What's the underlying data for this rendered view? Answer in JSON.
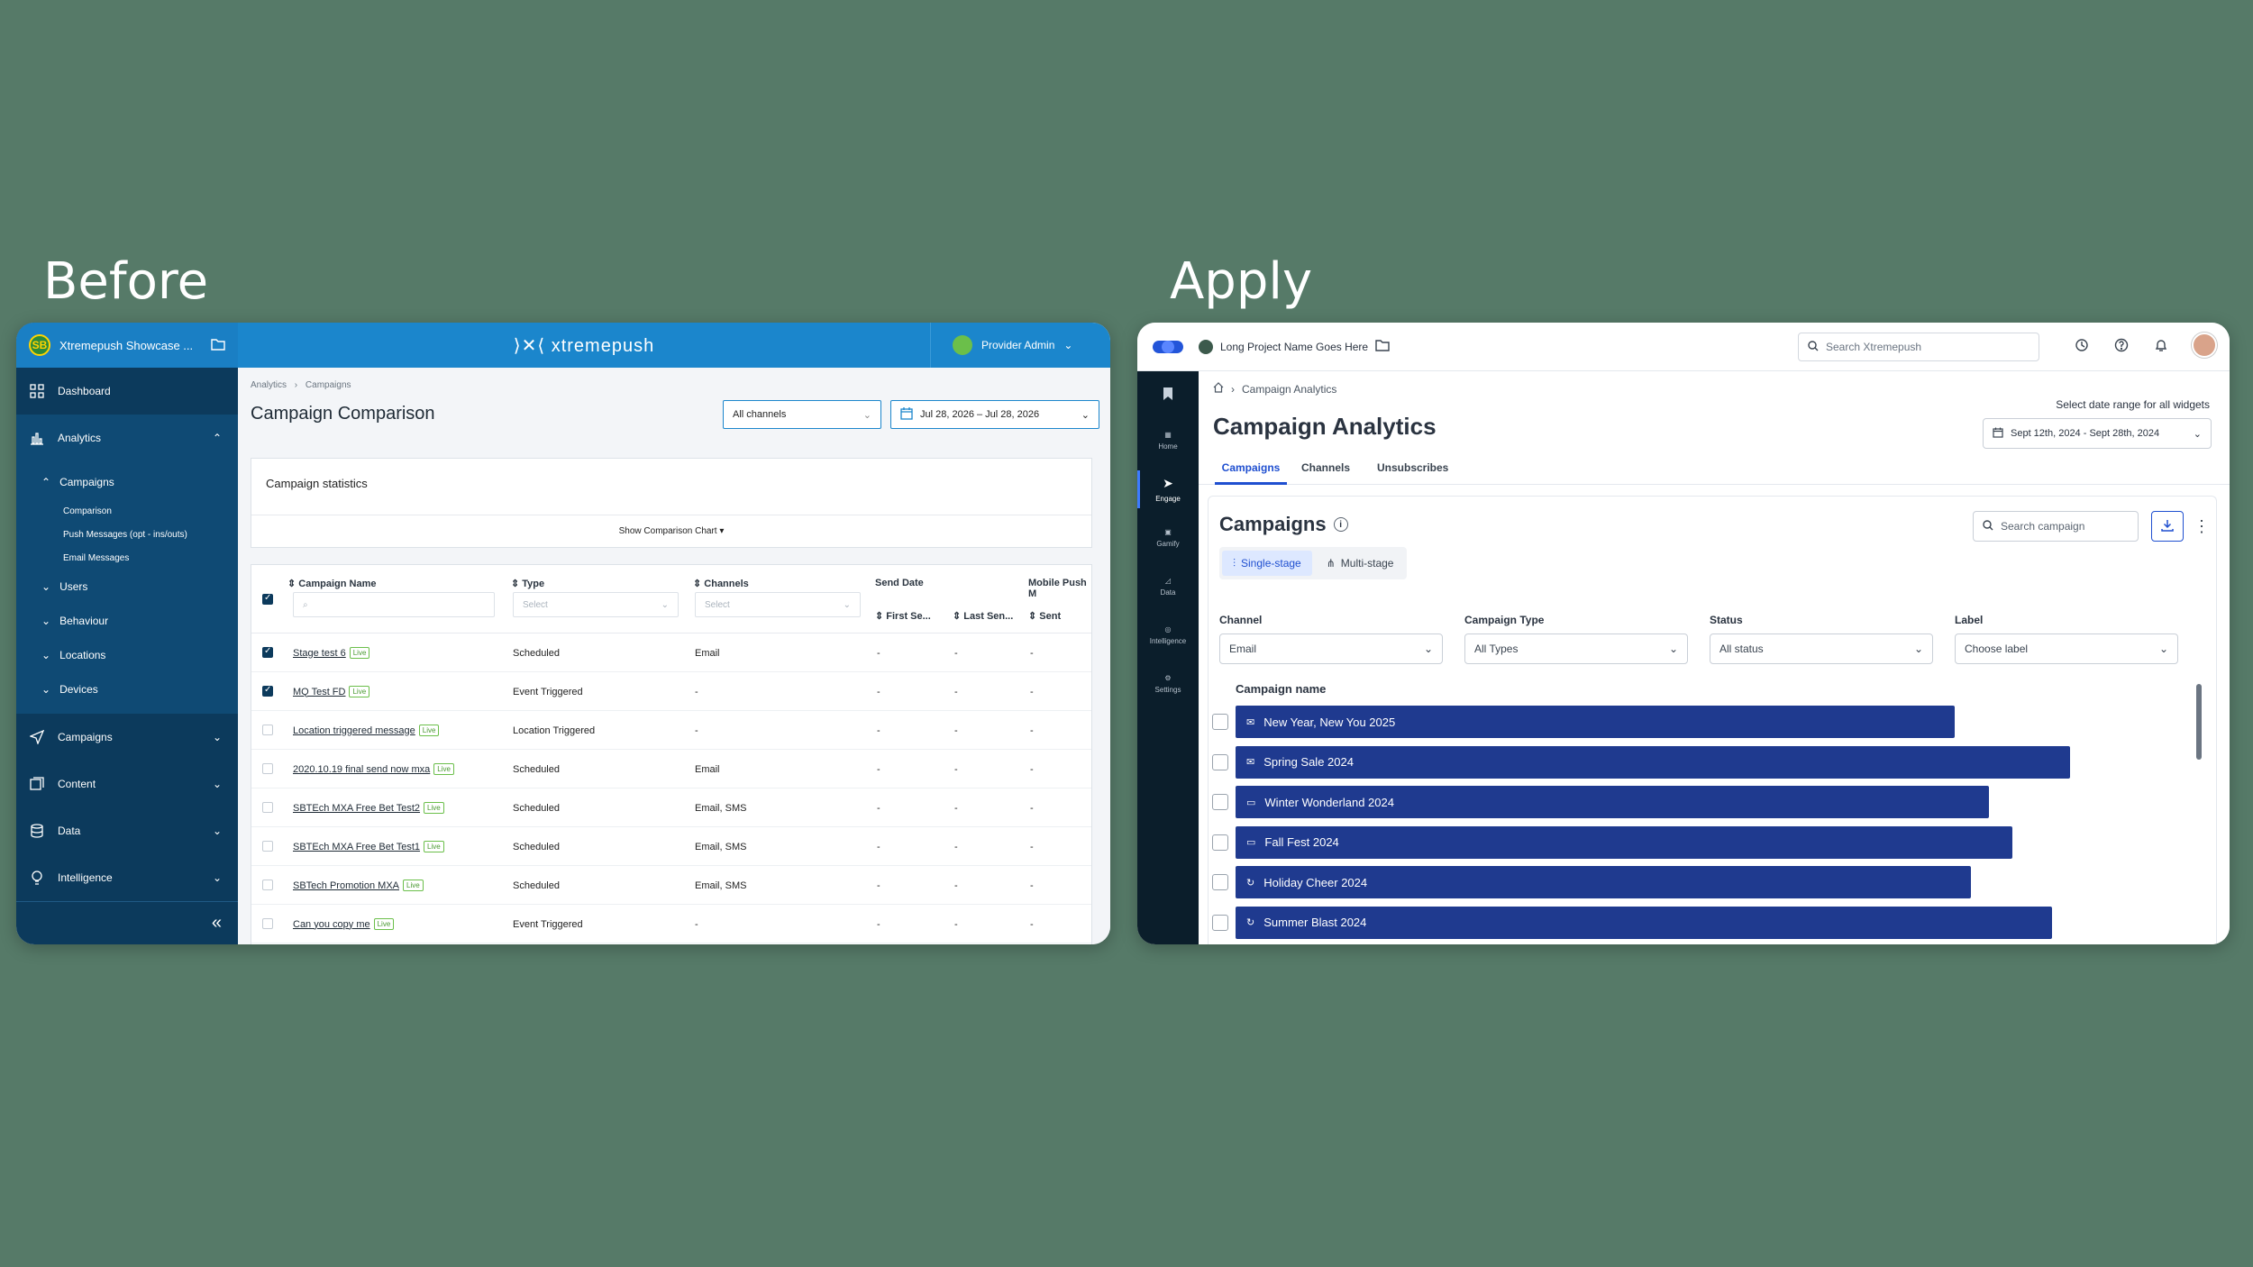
{
  "headings": {
    "before": "Before",
    "after": "Apply"
  },
  "before": {
    "workspace": "Xtremepush Showcase ...",
    "workspace_initials": "SB",
    "brand": "xtremepush",
    "user": "Provider Admin",
    "nav": {
      "dashboard": "Dashboard",
      "analytics": "Analytics",
      "campaigns_sub": "Campaigns",
      "comparison": "Comparison",
      "push_messages": "Push Messages (opt - ins/outs)",
      "email_messages": "Email Messages",
      "users": "Users",
      "behaviour": "Behaviour",
      "locations": "Locations",
      "devices": "Devices",
      "campaigns": "Campaigns",
      "content": "Content",
      "data": "Data",
      "intelligence": "Intelligence",
      "collapse": "«"
    },
    "breadcrumb": {
      "root": "Analytics",
      "sep": "›",
      "current": "Campaigns"
    },
    "page_title": "Campaign Comparison",
    "channels_select": "All channels",
    "date_range": "Jul 28, 2026 – Jul 28, 2026",
    "stats_title": "Campaign statistics",
    "show_chart": "Show Comparison Chart ▾",
    "table": {
      "headers": {
        "name": "Campaign Name",
        "type": "Type",
        "channels": "Channels",
        "send_date": "Send Date",
        "mobile_push": "Mobile Push M",
        "first_sent": "First Se...",
        "last_sent": "Last Sen...",
        "sent": "Sent"
      },
      "filter_placeholder": "Select",
      "live_label": "Live",
      "rows": [
        {
          "name": "Stage test 6",
          "type": "Scheduled",
          "channels": "Email",
          "first": "-",
          "last": "-",
          "sent": "-",
          "checked": true
        },
        {
          "name": "MQ Test FD",
          "type": "Event Triggered",
          "channels": "-",
          "first": "-",
          "last": "-",
          "sent": "-",
          "checked": true
        },
        {
          "name": "Location triggered message",
          "type": "Location Triggered",
          "channels": "-",
          "first": "-",
          "last": "-",
          "sent": "-",
          "checked": false
        },
        {
          "name": "2020.10.19 final send now mxa",
          "type": "Scheduled",
          "channels": "Email",
          "first": "-",
          "last": "-",
          "sent": "-",
          "checked": false
        },
        {
          "name": "SBTEch MXA Free Bet Test2",
          "type": "Scheduled",
          "channels": "Email, SMS",
          "first": "-",
          "last": "-",
          "sent": "-",
          "checked": false
        },
        {
          "name": "SBTEch MXA Free Bet Test1",
          "type": "Scheduled",
          "channels": "Email, SMS",
          "first": "-",
          "last": "-",
          "sent": "-",
          "checked": false
        },
        {
          "name": "SBTech Promotion MXA",
          "type": "Scheduled",
          "channels": "Email, SMS",
          "first": "-",
          "last": "-",
          "sent": "-",
          "checked": false
        },
        {
          "name": "Can you copy me",
          "type": "Event Triggered",
          "channels": "-",
          "first": "-",
          "last": "-",
          "sent": "-",
          "checked": false
        }
      ]
    }
  },
  "after": {
    "project": "Long Project Name Goes Here",
    "search_placeholder": "Search Xtremepush",
    "sidebar": [
      "Home",
      "Engage",
      "Gamify",
      "Data",
      "Intelligence",
      "Settings"
    ],
    "breadcrumb": "Campaign Analytics",
    "page_title": "Campaign Analytics",
    "range_label": "Select date range for all widgets",
    "range_value": "Sept 12th, 2024 - Sept 28th, 2024",
    "tabs": [
      "Campaigns",
      "Channels",
      "Unsubscribes"
    ],
    "card_title": "Campaigns",
    "segments": [
      "Single-stage",
      "Multi-stage"
    ],
    "card_search_placeholder": "Search campaign",
    "filters": [
      {
        "label": "Channel",
        "value": "Email"
      },
      {
        "label": "Campaign Type",
        "value": "All Types"
      },
      {
        "label": "Status",
        "value": "All status"
      },
      {
        "label": "Label",
        "value": "Choose label"
      }
    ],
    "column_header": "Campaign name",
    "campaigns": [
      {
        "name": "New Year, New You 2025",
        "icon": "email-icon"
      },
      {
        "name": "Spring Sale 2024",
        "icon": "email-icon"
      },
      {
        "name": "Winter Wonderland 2024",
        "icon": "message-icon"
      },
      {
        "name": "Fall Fest 2024",
        "icon": "message-icon"
      },
      {
        "name": "Holiday Cheer 2024",
        "icon": "push-icon"
      },
      {
        "name": "Summer Blast 2024",
        "icon": "push-icon"
      }
    ],
    "bar_color": "#1f3a8f",
    "accent_color": "#1f4fd0"
  }
}
